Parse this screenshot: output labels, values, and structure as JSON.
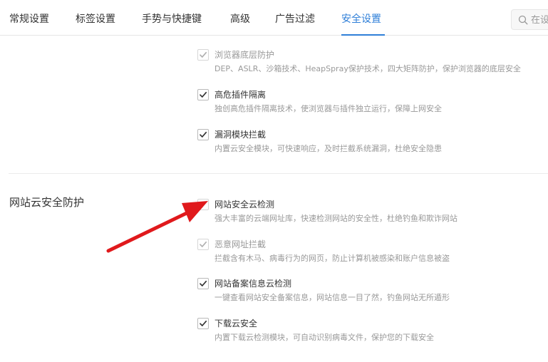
{
  "tabs": [
    {
      "label": "常规设置"
    },
    {
      "label": "标签设置"
    },
    {
      "label": "手势与快捷键"
    },
    {
      "label": "高级"
    },
    {
      "label": "广告过滤"
    },
    {
      "label": "安全设置",
      "active": true
    }
  ],
  "search": {
    "placeholder": "在设"
  },
  "upper_options": [
    {
      "label": "浏览器底层防护",
      "desc": "DEP、ASLR、沙箱技术、HeapSpray保护技术，四大矩阵防护，保护浏览器的底层安全",
      "checked": true,
      "disabled": true
    },
    {
      "label": "高危插件隔离",
      "desc": "独创高危插件隔离技术，使浏览器与插件独立运行，保障上网安全",
      "checked": true,
      "disabled": false
    },
    {
      "label": "漏洞模块拦截",
      "desc": "内置云安全模块，可快速响应，及时拦截系统漏洞，杜绝安全隐患",
      "checked": true,
      "disabled": false
    }
  ],
  "cloud_section": {
    "title": "网站云安全防护",
    "options": [
      {
        "label": "网站安全云检测",
        "desc": "强大丰富的云端网址库，快速检测网站的安全性，杜绝钓鱼和欺诈网站",
        "checked": true,
        "disabled": true
      },
      {
        "label": "恶意网址拦截",
        "desc": "拦截含有木马、病毒行为的网页，防止计算机被感染和账户信息被盗",
        "checked": true,
        "disabled": true
      },
      {
        "label": "网站备案信息云检测",
        "desc": "一键查看网站安全备案信息，网站信息一目了然，钓鱼网站无所遁形",
        "checked": true,
        "disabled": false
      },
      {
        "label": "下载云安全",
        "desc": "内置下载云检测模块，可自动识别病毒文件，保护您的下载安全",
        "checked": true,
        "disabled": false
      }
    ]
  },
  "colors": {
    "accent": "#2f7fd8",
    "annotation_arrow": "#e0191c"
  }
}
